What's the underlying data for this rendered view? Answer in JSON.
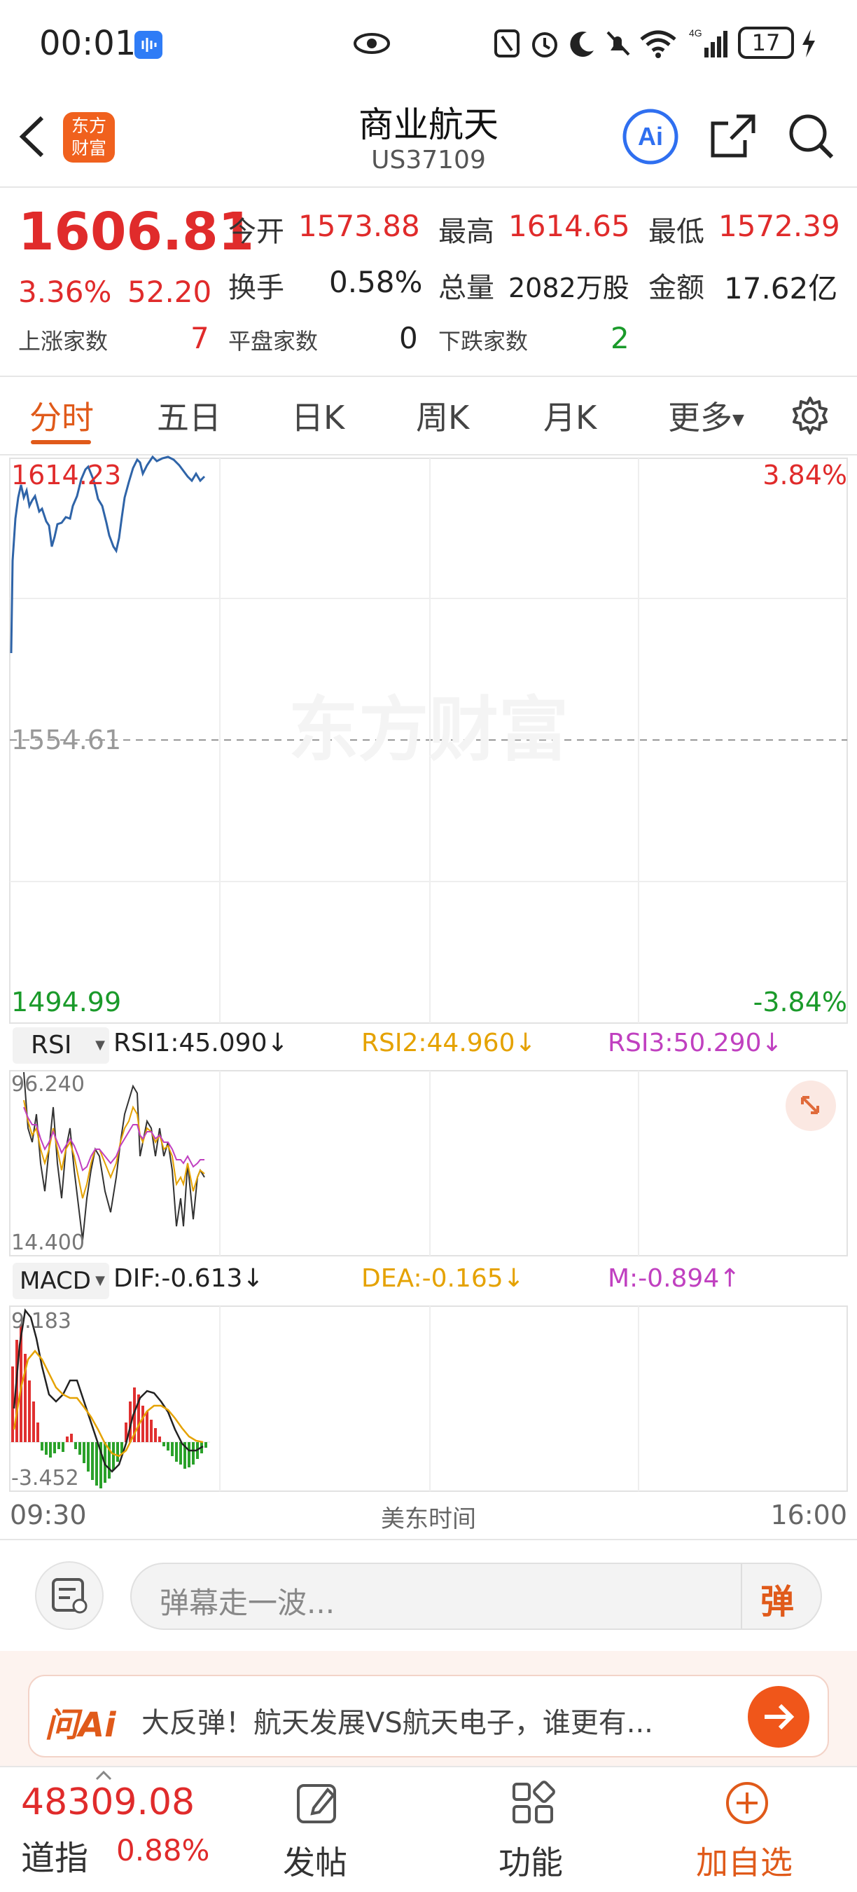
{
  "status_bar": {
    "time": "00:01",
    "battery": "17"
  },
  "header": {
    "title": "商业航天",
    "code": "US37109",
    "logo_text": "东方财富"
  },
  "quote": {
    "price": "1606.81",
    "change_pct": "3.36%",
    "change_amt": "52.20",
    "open_label": "今开",
    "open_val": "1573.88",
    "high_label": "最高",
    "high_val": "1614.65",
    "low_label": "最低",
    "low_val": "1572.39",
    "turnover_label": "换手",
    "turnover_val": "0.58%",
    "volume_label": "总量",
    "volume_val": "2082万股",
    "amount_label": "金额",
    "amount_val": "17.62亿",
    "up_label": "上涨家数",
    "up_val": "7",
    "flat_label": "平盘家数",
    "flat_val": "0",
    "down_label": "下跌家数",
    "down_val": "2"
  },
  "tabs": [
    "分时",
    "五日",
    "日K",
    "周K",
    "月K",
    "更多"
  ],
  "chart": {
    "top_price": "1614.23",
    "top_pct": "3.84%",
    "mid_price": "1554.61",
    "bottom_price": "1494.99",
    "bottom_pct": "-3.84%",
    "watermark": "东方财富"
  },
  "rsi": {
    "label": "RSI",
    "rsi1": "RSI1:45.090↓",
    "rsi2": "RSI2:44.960↓",
    "rsi3": "RSI3:50.290↓",
    "top": "96.240",
    "bottom": "14.400"
  },
  "macd": {
    "label": "MACD",
    "dif": "DIF:-0.613↓",
    "dea": "DEA:-0.165↓",
    "m": "M:-0.894↑",
    "top": "9.183",
    "bottom": "-3.452"
  },
  "time_axis": {
    "start": "09:30",
    "center": "美东时间",
    "end": "16:00"
  },
  "comment": {
    "placeholder": "弹幕走一波...",
    "danmaku_label": "弹"
  },
  "ai_banner": {
    "brand": "问Ai",
    "text": "大反弹！航天发展VS航天电子，谁更有..."
  },
  "footer": {
    "index_value": "48309.08",
    "index_name": "道指",
    "index_pct": "0.88%",
    "post_label": "发帖",
    "func_label": "功能",
    "add_label": "加自选"
  },
  "colors": {
    "up": "#e02b2b",
    "down": "#1a9a2a",
    "accent": "#f0611e",
    "line": "#2f64a8"
  }
}
